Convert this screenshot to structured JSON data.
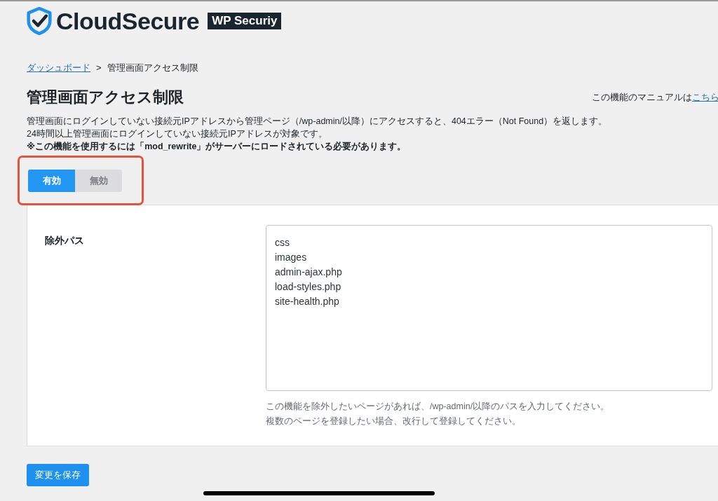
{
  "logo": {
    "name": "CloudSecure",
    "badge": "WP Securiy"
  },
  "breadcrumb": [
    {
      "label": "ダッシュボード",
      "kind": "link"
    },
    {
      "label": ">",
      "kind": "separator"
    },
    {
      "label": "管理画面アクセス制限",
      "kind": "current"
    }
  ],
  "title": "管理画面アクセス制限",
  "manual": {
    "text": "この機能のマニュアルは",
    "link": "こちら"
  },
  "description": [
    {
      "text": "管理画面にログインしていない接続元IPアドレスから管理ページ（/wp-admin/以降）にアクセスすると、404エラー（Not Found）を返します。",
      "bold": false
    },
    {
      "text": "24時間以上管理画面にログインしていない接続元IPアドレスが対象です。",
      "bold": false
    },
    {
      "text": "※この機能を使用するには「mod_rewrite」がサーバーにロードされている必要があります。",
      "bold": true
    }
  ],
  "toggle": [
    {
      "label": "有効",
      "selected": true
    },
    {
      "label": "無効",
      "selected": false
    }
  ],
  "settings": {
    "label": "除外パス",
    "value": [
      "css",
      "images",
      "admin-ajax.php",
      "load-styles.php",
      "site-health.php"
    ],
    "help": [
      "この機能を除外したいページがあれば、/wp-admin/以降のパスを入力してください。",
      "複数のページを登録したい場合、改行して登録してください。"
    ]
  },
  "save_button": "変更を保存"
}
